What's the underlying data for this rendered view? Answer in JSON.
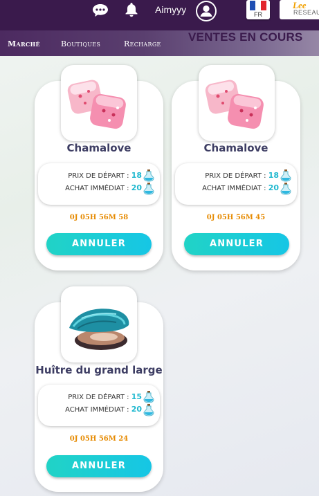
{
  "header": {
    "username": "Aimyyy",
    "language_code": "FR",
    "brand_logo": "Lee",
    "brand_network": "RESEAU",
    "flag_colors": [
      "#1f4fb4",
      "#ffffff",
      "#e2262c"
    ]
  },
  "nav": {
    "tabs": [
      {
        "label": "Marché",
        "active": true
      },
      {
        "label": "Boutiques",
        "active": false
      },
      {
        "label": "Recharge",
        "active": false
      }
    ]
  },
  "section": {
    "title": "VENTES EN COURS"
  },
  "labels": {
    "start_price": "PRIX DE DÉPART :",
    "buy_now": "ACHAT IMMÉDIAT :",
    "cancel": "ANNULER"
  },
  "listings": [
    {
      "name": "Chamalove",
      "start_price": "18",
      "buy_now": "20",
      "time_left": "0J 05H 56M 58",
      "icon": "marshmallow-icon"
    },
    {
      "name": "Chamalove",
      "start_price": "18",
      "buy_now": "20",
      "time_left": "0J 05H 56M 45",
      "icon": "marshmallow-icon"
    },
    {
      "name": "Huître du grand large",
      "start_price": "15",
      "buy_now": "20",
      "time_left": "0J 05H 56M 24",
      "icon": "oyster-icon"
    }
  ],
  "colors": {
    "header_bg": "#3a1a4c",
    "accent_cyan": "#1fb8cf",
    "timer_orange": "#e68a00",
    "button_gradient": [
      "#21d3c6",
      "#16c6e5"
    ]
  }
}
